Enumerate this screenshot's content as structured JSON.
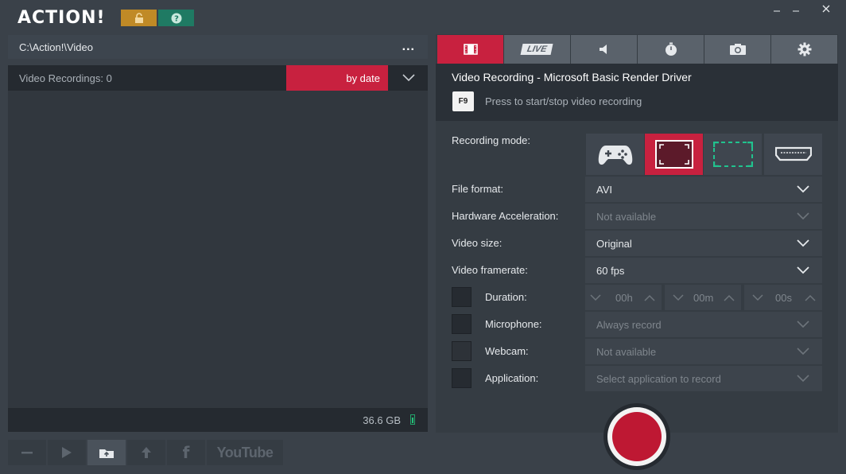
{
  "app": {
    "logo": "ACTION!"
  },
  "left": {
    "path": "C:\\Action!\\Video",
    "more_label": "...",
    "list_count": "Video Recordings: 0",
    "sort_label": "by date",
    "disk_free": "36.6 GB",
    "youtube_label": "YouTube"
  },
  "right": {
    "tabs": [
      "video-recording",
      "live",
      "audio",
      "benchmark",
      "screenshot",
      "settings"
    ],
    "tab_live_label": "LIVE",
    "title": "Video Recording - Microsoft Basic Render Driver",
    "hotkey": "F9",
    "hotkey_hint": "Press to start/stop video recording",
    "recording_mode_label": "Recording mode:",
    "recording_modes": [
      "game",
      "desktop",
      "area",
      "device"
    ],
    "recording_mode_selected": "desktop",
    "file_format_label": "File format:",
    "file_format": "AVI",
    "hw_accel_label": "Hardware Acceleration:",
    "hw_accel": "Not available",
    "video_size_label": "Video size:",
    "video_size": "Original",
    "framerate_label": "Video framerate:",
    "framerate": "60 fps",
    "duration_label": "Duration:",
    "duration_h": "00h",
    "duration_m": "00m",
    "duration_s": "00s",
    "microphone_label": "Microphone:",
    "microphone": "Always record",
    "webcam_label": "Webcam:",
    "webcam": "Not available",
    "application_label": "Application:",
    "application_placeholder": "Select application to record"
  },
  "colors": {
    "accent": "#c8213f",
    "lock": "#c08a26",
    "help": "#1f7a63",
    "area_green": "#21c28e"
  }
}
